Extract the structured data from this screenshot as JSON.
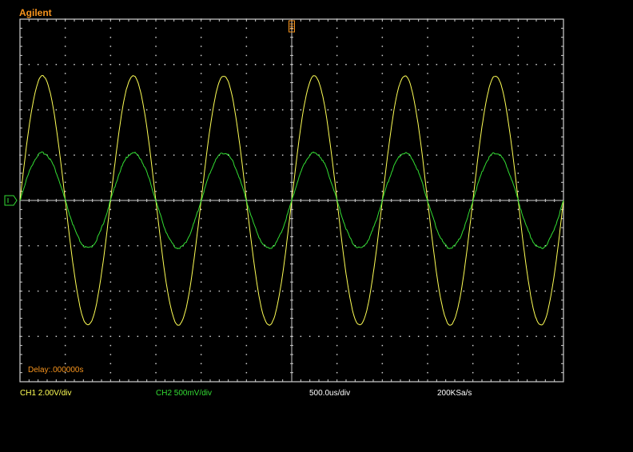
{
  "brand": "Agilent",
  "delay_text": "Delay:.000000s",
  "status": {
    "ch1": "CH1 2.00V/div",
    "ch2": "CH2 500mV/div",
    "timebase": "500.0us/div",
    "sample_rate": "200KSa/s"
  },
  "colors": {
    "ch1": "#ffff55",
    "ch2": "#33dd33",
    "brand": "#f7941d",
    "grid": "#d0d0d0",
    "background": "#000000"
  },
  "icons": {
    "trigger_marker": "trigger-position-marker",
    "ground_marker": "channel-ground-marker"
  },
  "traces": {
    "ch1": {
      "amplitude_div": 2.75,
      "period_div": 2.0,
      "phase_div": 0.0,
      "offset_div": 0.0
    },
    "ch2": {
      "amplitude_div": 1.05,
      "period_div": 2.0,
      "phase_div": 0.0,
      "offset_div": 0.0
    }
  }
}
